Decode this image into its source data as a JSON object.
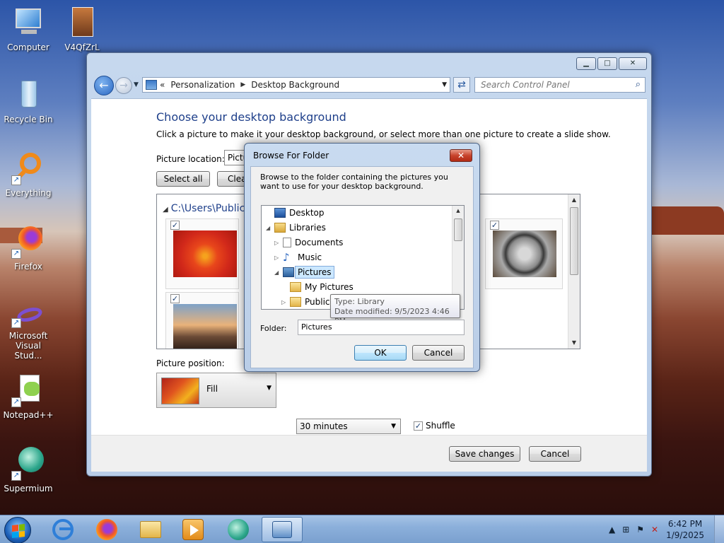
{
  "desktop": {
    "icons": [
      {
        "label": "Computer",
        "icon": "computer-icon"
      },
      {
        "label": "V4QfZrL",
        "icon": "image-file-icon"
      },
      {
        "label": "Recycle Bin",
        "icon": "recycle-bin-icon"
      },
      {
        "label": "Everything",
        "icon": "everything-search-icon"
      },
      {
        "label": "Firefox",
        "icon": "firefox-icon"
      },
      {
        "label": "Microsoft Visual Stud...",
        "icon": "visual-studio-icon"
      },
      {
        "label": "Notepad++",
        "icon": "notepadpp-icon"
      },
      {
        "label": "Supermium",
        "icon": "supermium-icon"
      }
    ]
  },
  "window": {
    "breadcrumb": {
      "overflow": "«",
      "items": [
        "Personalization",
        "Desktop Background"
      ]
    },
    "search_placeholder": "Search Control Panel",
    "heading": "Choose your desktop background",
    "description": "Click a picture to make it your desktop background, or select more than one picture to create a slide show.",
    "picture_location_label": "Picture location:",
    "picture_location_value": "Pictures Library",
    "select_all": "Select all",
    "clear_all": "Clear all",
    "gallery_path": "C:\\Users\\Public\\Pictures\\Sample Pictures",
    "picture_position_label": "Picture position:",
    "picture_position_value": "Fill",
    "interval_value": "30 minutes",
    "shuffle_label": "Shuffle",
    "shuffle_checked": true,
    "save_button": "Save changes",
    "cancel_button": "Cancel"
  },
  "dialog": {
    "title": "Browse For Folder",
    "close": "✕",
    "description": "Browse to the folder containing the pictures you want to use for your desktop background.",
    "tree": [
      {
        "label": "Desktop",
        "icon": "desktop-folder-icon",
        "expander": ""
      },
      {
        "label": "Libraries",
        "icon": "libraries-icon",
        "expander": "◢"
      },
      {
        "label": "Documents",
        "icon": "documents-icon",
        "expander": "▷"
      },
      {
        "label": "Music",
        "icon": "music-icon",
        "expander": "▷"
      },
      {
        "label": "Pictures",
        "icon": "pictures-library-icon",
        "expander": "◢",
        "selected": true
      },
      {
        "label": "My Pictures",
        "icon": "folder-icon",
        "expander": ""
      },
      {
        "label": "Public Pictures",
        "icon": "folder-icon",
        "expander": "▷"
      }
    ],
    "tooltip": {
      "line1": "Type: Library",
      "line2": "Date modified: 9/5/2023 4:46 PM"
    },
    "folder_label": "Folder:",
    "folder_value": "Pictures",
    "ok_button": "OK",
    "cancel_button": "Cancel"
  },
  "taskbar": {
    "time": "6:42 PM",
    "date": "1/9/2025",
    "tray_arrow": "▲"
  }
}
